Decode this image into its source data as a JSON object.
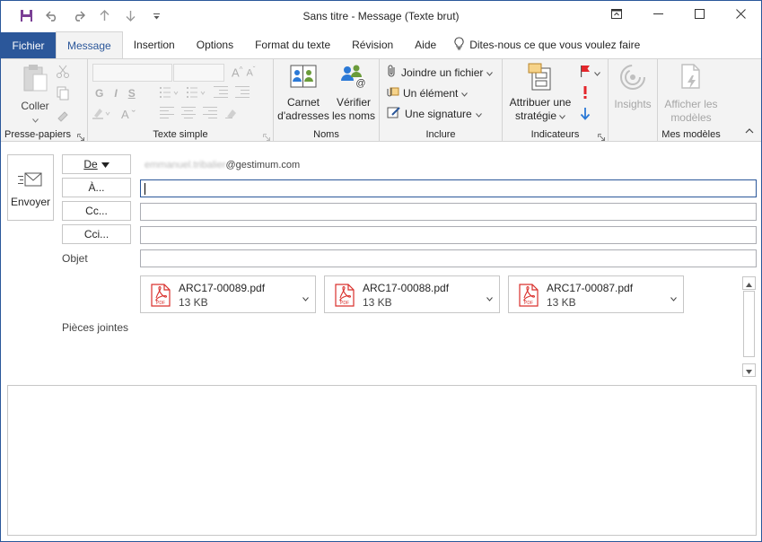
{
  "window": {
    "title": "Sans titre  -  Message (Texte brut)"
  },
  "tabs": {
    "file": "Fichier",
    "items": [
      "Message",
      "Insertion",
      "Options",
      "Format du texte",
      "Révision",
      "Aide"
    ],
    "active": "Message",
    "tell_me": "Dites-nous ce que vous voulez faire"
  },
  "ribbon": {
    "clipboard": {
      "paste": "Coller",
      "label": "Presse-papiers"
    },
    "basic_text": {
      "label": "Texte simple",
      "bold": "G",
      "italic": "I",
      "underline": "S"
    },
    "names": {
      "address_book_1": "Carnet",
      "address_book_2": "d'adresses",
      "check_names_1": "Vérifier",
      "check_names_2": "les noms",
      "label": "Noms"
    },
    "include": {
      "attach_file": "Joindre un fichier",
      "item": "Un élément",
      "signature": "Une signature",
      "label": "Inclure"
    },
    "tags": {
      "assign_policy_1": "Attribuer une",
      "assign_policy_2": "stratégie",
      "label": "Indicateurs"
    },
    "insights": {
      "label_btn": "Insights"
    },
    "templates": {
      "view_1": "Afficher les",
      "view_2": "modèles",
      "label": "Mes modèles"
    }
  },
  "compose": {
    "send": "Envoyer",
    "from_button": "De",
    "from_value_blurred": "emmanuel.tribalier",
    "from_value_domain": "@gestimum.com",
    "to_button": "À...",
    "cc_button": "Cc...",
    "bcc_button": "Cci...",
    "subject_label": "Objet",
    "attachments_label": "Pièces jointes",
    "attachments": [
      {
        "name": "ARC17-00089.pdf",
        "size": "13 KB"
      },
      {
        "name": "ARC17-00088.pdf",
        "size": "13 KB"
      },
      {
        "name": "ARC17-00087.pdf",
        "size": "13 KB"
      }
    ],
    "pdf_badge": "PDF"
  },
  "colors": {
    "accent": "#2b579a",
    "ribbon_bg": "#f3f3f3",
    "pdf_red": "#d9302c",
    "flag_red": "#e3262b",
    "arrow_blue": "#2b79d6"
  }
}
